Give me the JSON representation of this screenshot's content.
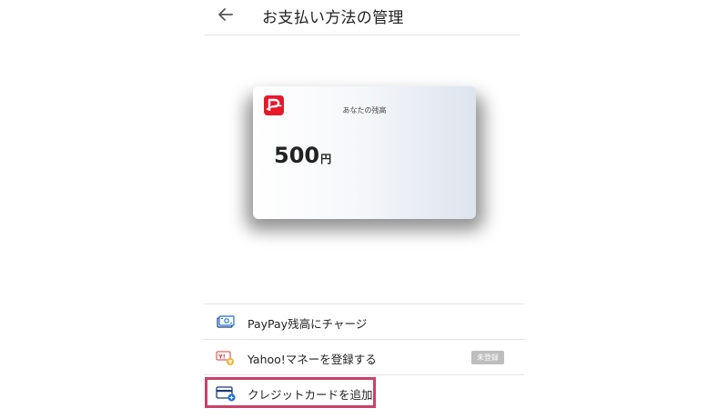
{
  "header": {
    "title": "お支払い方法の管理",
    "back_icon": "arrow-left-icon"
  },
  "card": {
    "logo_icon": "paypay-logo-icon",
    "logo_color": "#e8182b",
    "balance_label": "あなたの残高",
    "balance_amount": "500",
    "balance_unit": "円"
  },
  "menu": {
    "items": [
      {
        "label": "PayPay残高にチャージ",
        "icon": "charge-money-icon"
      },
      {
        "label": "Yahoo!マネーを登録する",
        "icon": "yahoo-money-icon",
        "badge": "未登録"
      },
      {
        "label": "クレジットカードを追加",
        "icon": "add-credit-card-icon",
        "highlighted": true
      }
    ]
  },
  "colors": {
    "accent_blue": "#1a6fd6",
    "highlight_border": "#c9416a",
    "badge_bg": "#bdbdbd"
  }
}
